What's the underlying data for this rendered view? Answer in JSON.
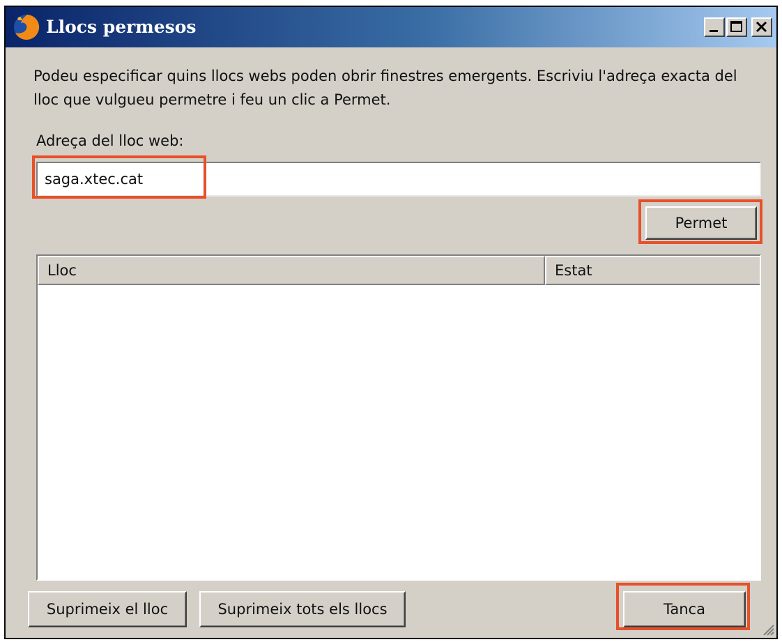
{
  "window": {
    "title": "Llocs permesos",
    "controls": [
      "minimize-icon",
      "maximize-icon",
      "close-icon"
    ]
  },
  "description": "Podeu especificar quins llocs webs poden obrir finestres emergents. Escriviu l'adreça exacta del lloc que vulgueu permetre i feu un clic a Permet.",
  "address": {
    "label": "Adreça del lloc web:",
    "value": "saga.xtec.cat"
  },
  "buttons": {
    "permet": "Permet",
    "remove_site": "Suprimeix el lloc",
    "remove_all": "Suprimeix tots els llocs",
    "close": "Tanca"
  },
  "list": {
    "columns": [
      "Lloc",
      "Estat"
    ],
    "rows": []
  },
  "colors": {
    "highlight": "#e8502a",
    "dialog_bg": "#d4d0c8",
    "title_start": "#0a246a",
    "title_end": "#a6caf0"
  }
}
